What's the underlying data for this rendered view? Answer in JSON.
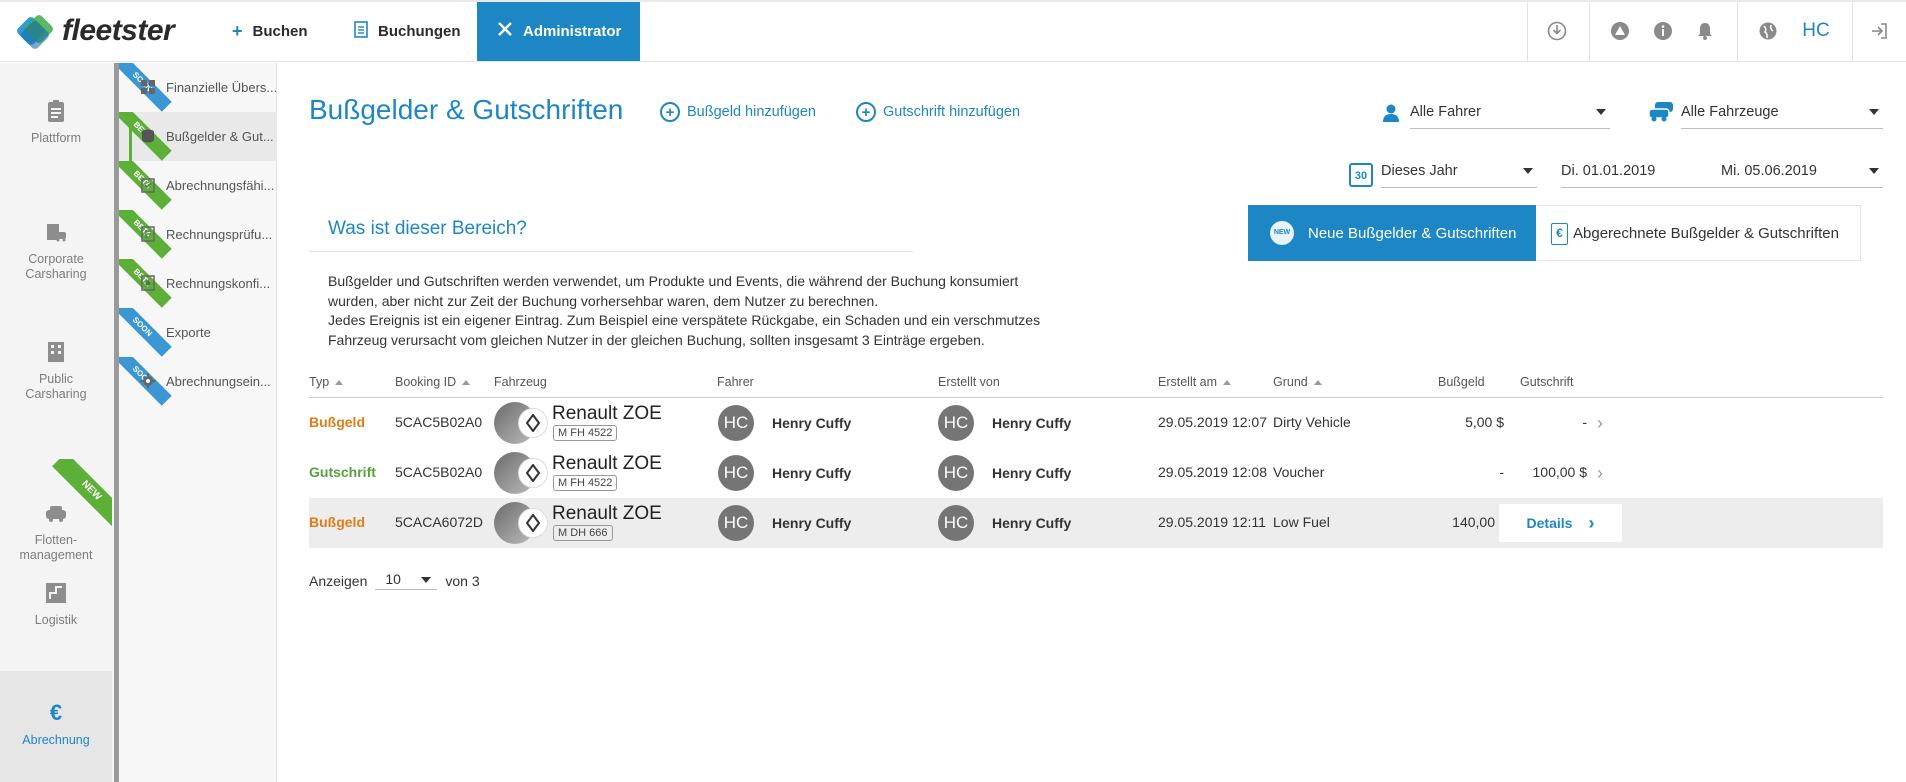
{
  "brand": {
    "name": "fleetster"
  },
  "topnav": {
    "book": "Buchen",
    "bookings": "Buchungen",
    "admin": "Administrator",
    "user_initials": "HC"
  },
  "sidebar": {
    "items": [
      {
        "label": "Plattform"
      },
      {
        "label": "Corporate Carsharing"
      },
      {
        "label": "Public Carsharing"
      },
      {
        "label": "Flotten-management",
        "badge": "NEW"
      },
      {
        "label": "Logistik"
      },
      {
        "label": "Abrechnung"
      }
    ]
  },
  "subnav": {
    "items": [
      {
        "label": "Finanzielle Übers...",
        "ribbon": "SOON"
      },
      {
        "label": "Bußgelder & Gut...",
        "ribbon": "BETA"
      },
      {
        "label": "Abrechnungsfähi...",
        "ribbon": "BETA"
      },
      {
        "label": "Rechnungsprüfu...",
        "ribbon": "BETA"
      },
      {
        "label": "Rechnungskonfi...",
        "ribbon": "BETA"
      },
      {
        "label": "Exporte",
        "ribbon": "SOON"
      },
      {
        "label": "Abrechnungsein...",
        "ribbon": "SOON"
      }
    ]
  },
  "page": {
    "title": "Bußgelder & Gutschriften",
    "add_fine": "Bußgeld hinzufügen",
    "add_credit": "Gutschrift hinzufügen"
  },
  "filters": {
    "drivers": "Alle Fahrer",
    "vehicles": "Alle Fahrzeuge",
    "period": "Dieses Jahr",
    "date_from": "Di. 01.01.2019",
    "date_to": "Mi. 05.06.2019",
    "calendar_day": "30"
  },
  "info": {
    "title": "Was ist dieser Bereich?",
    "line1": "Bußgelder und Gutschriften werden verwendet, um Produkte und Events, die während der Buchung konsumiert",
    "line2": "wurden, aber nicht zur Zeit der Buchung vorhersehbar waren, dem Nutzer zu berechnen.",
    "line3": "Jedes Ereignis ist ein eigener Eintrag. Zum Beispiel eine verspätete Rückgabe, ein Schaden und ein verschmutzes",
    "line4": "Fahrzeug verursacht vom gleichen Nutzer in der gleichen Buchung, sollten insgesamt 3 Einträge ergeben."
  },
  "views": {
    "new": "Neue Bußgelder & Gutschriften",
    "new_badge": "NEW",
    "settled": "Abgerechnete Bußgelder & Gutschriften"
  },
  "table": {
    "headers": {
      "type": "Typ",
      "booking_id": "Booking ID",
      "vehicle": "Fahrzeug",
      "driver": "Fahrer",
      "created_by": "Erstellt von",
      "created_at": "Erstellt am",
      "reason": "Grund",
      "fine": "Bußgeld",
      "credit": "Gutschrift"
    },
    "rows": [
      {
        "type": "Bußgeld",
        "booking_id": "5CAC5B02A0",
        "vehicle": "Renault ZOE",
        "plate": "M FH 4522",
        "driver_initials": "HC",
        "driver": "Henry Cuffy",
        "creator_initials": "HC",
        "creator": "Henry Cuffy",
        "created_at": "29.05.2019 12:07",
        "reason": "Dirty Vehicle",
        "fine": "5,00 $",
        "credit": "-"
      },
      {
        "type": "Gutschrift",
        "booking_id": "5CAC5B02A0",
        "vehicle": "Renault ZOE",
        "plate": "M FH 4522",
        "driver_initials": "HC",
        "driver": "Henry Cuffy",
        "creator_initials": "HC",
        "creator": "Henry Cuffy",
        "created_at": "29.05.2019 12:08",
        "reason": "Voucher",
        "fine": "-",
        "credit": "100,00 $"
      },
      {
        "type": "Bußgeld",
        "booking_id": "5CACA6072D",
        "vehicle": "Renault ZOE",
        "plate": "M DH 666",
        "driver_initials": "HC",
        "driver": "Henry Cuffy",
        "creator_initials": "HC",
        "creator": "Henry Cuffy",
        "created_at": "29.05.2019 12:11",
        "reason": "Low Fuel",
        "fine": "140,00",
        "credit": "",
        "details": "Details"
      }
    ]
  },
  "pagination": {
    "show": "Anzeigen",
    "page_size": "10",
    "of": "von 3"
  },
  "colors": {
    "accent": "#1d87c5",
    "fine": "#e37b16",
    "credit": "#5aa03b",
    "beta": "#5cb038",
    "soon": "#3a97d4"
  }
}
